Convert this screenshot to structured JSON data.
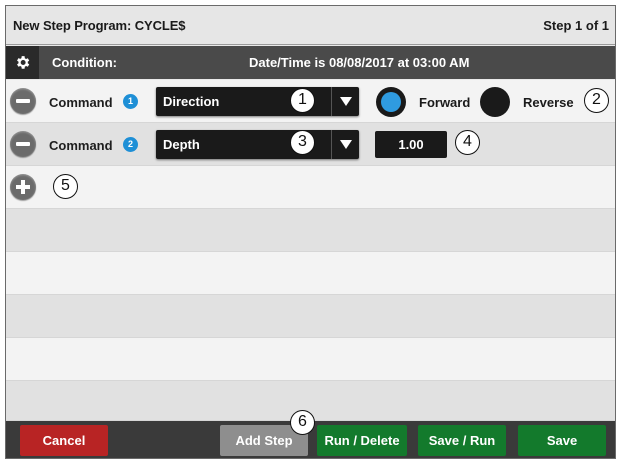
{
  "header": {
    "program_label": "New Step Program:",
    "program_name": "CYCLE$",
    "step_indicator": "Step 1 of 1"
  },
  "condition": {
    "icon": "gear-icon",
    "label": "Condition:",
    "value": "Date/Time is 08/08/2017 at 03:00 AM"
  },
  "commands": [
    {
      "label": "Command",
      "badge": "1",
      "select_value": "Direction",
      "options": [
        {
          "label": "Forward",
          "selected": true
        },
        {
          "label": "Reverse",
          "selected": false
        }
      ]
    },
    {
      "label": "Command",
      "badge": "2",
      "select_value": "Depth",
      "value": "1.00"
    }
  ],
  "callouts": [
    "1",
    "2",
    "3",
    "4",
    "5",
    "6"
  ],
  "footer": {
    "cancel": "Cancel",
    "add_step": "Add Step",
    "run_delete": "Run / Delete",
    "save_run": "Save / Run",
    "save": "Save"
  },
  "colors": {
    "accent_blue": "#2f9be0",
    "cancel_red": "#b82424",
    "action_green": "#137a2c",
    "disabled_grey": "#8e8e8e"
  }
}
